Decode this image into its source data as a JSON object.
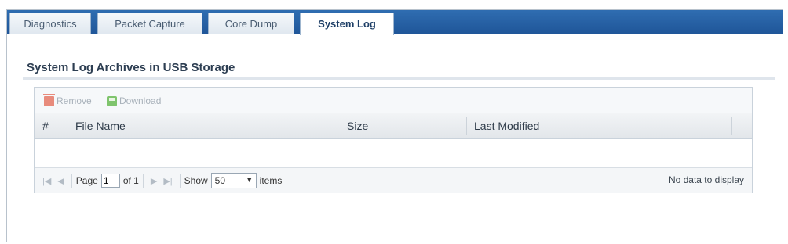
{
  "tabs": [
    {
      "label": "Diagnostics",
      "active": false
    },
    {
      "label": "Packet Capture",
      "active": false
    },
    {
      "label": "Core Dump",
      "active": false
    },
    {
      "label": "System Log",
      "active": true
    }
  ],
  "section": {
    "title": "System Log Archives in USB Storage"
  },
  "toolbar": {
    "remove_label": "Remove",
    "download_label": "Download"
  },
  "table": {
    "columns": [
      "#",
      "File Name",
      "Size",
      "Last Modified"
    ],
    "rows": []
  },
  "pager": {
    "page_label": "Page",
    "page_value": "1",
    "of_label": "of 1",
    "show_label": "Show",
    "show_value": "50",
    "items_label": "items",
    "status": "No data to display"
  },
  "icons": {
    "remove": "trash-icon",
    "download": "disk-icon",
    "first": "first-page-icon",
    "prev": "prev-page-icon",
    "next": "next-page-icon",
    "last": "last-page-icon"
  }
}
